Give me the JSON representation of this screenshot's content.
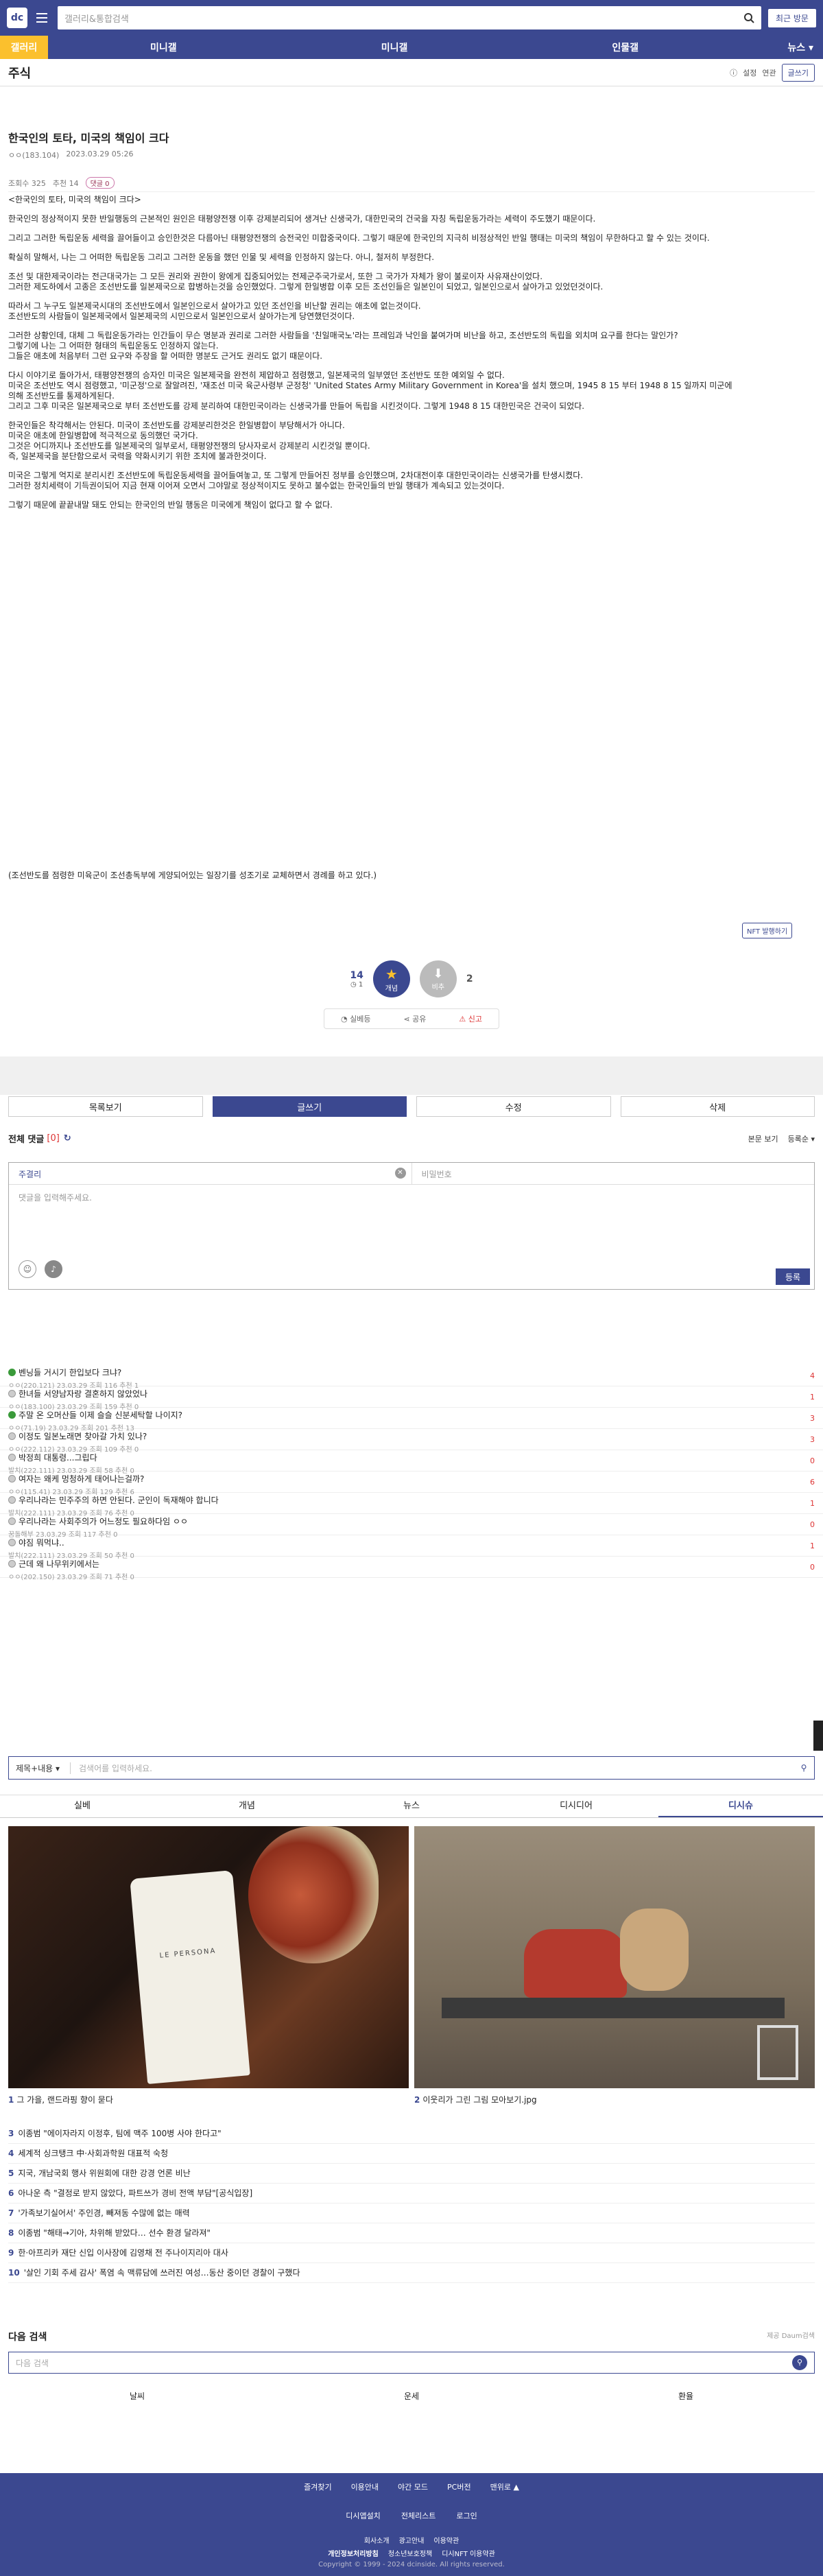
{
  "header": {
    "logo": "dc",
    "search_placeholder": "갤러리&통합검색",
    "recent_label": "최근 방문"
  },
  "gnb": [
    "갤러리",
    "미니갤",
    "미니갤",
    "인물갤",
    "뉴스"
  ],
  "gallery": {
    "title": "주식",
    "setting_label": "설정",
    "link_label": "연관",
    "write_label": "글쓰기"
  },
  "post": {
    "title": "한국인의 토타, 미국의 책임이 크다",
    "author": "ㅇㅇ(183.104)",
    "date": "2023.03.29 05:26",
    "views": "조회수 325",
    "recommend": "추천 14",
    "comments_badge": "댓글 0",
    "paragraphs": [
      [
        "<한국인의 토타, 미국의 책임이 크다>"
      ],
      [
        "한국인의 정상적이지 못한 반일행동의 근본적인 원인은 태평양전쟁 이후 강제분리되어 생겨난 신생국가, 대한민국의 건국을 자칭 독립운동가라는 세력이 주도했기 때문이다."
      ],
      [
        "그리고 그러한 독립운동 세력을 끌어들이고 승인한것은 다름아닌 태평양전쟁의 승전국인 미합중국이다. 그렇기 때문에 한국인의 지극히 비정상적인 반일 행태는 미국의 책임이 무한하다고 할 수 있는 것이다."
      ],
      [
        "확실히 말해서, 나는 그 어떠한 독립운동 그리고 그러한 운동을 했던 인물 및 세력을 인정하지 않는다. 아니, 철저히 부정한다."
      ],
      [
        "조선 및 대한제국이라는 전근대국가는 그 모든 권리와 권한이 왕에게 집중되어있는 전제군주국가로서, 또한 그 국가가 자체가 왕이 불로이자 사유재산이었다.",
        "그러한 제도하에서 고종은 조선반도를 일본제국으로 합병하는것을 승인했었다. 그렇게 한일병합 이후 모든 조선인들은 일본인이 되었고, 일본인으로서 살아가고 있었던것이다."
      ],
      [
        "따라서 그 누구도 일본제국시대의 조선반도에서 일본인으로서 살아가고 있던 조선인을 비난할 권리는 애초에 없는것이다.",
        "조선반도의 사람들이 일본제국에서 일본제국의 시민으로서 일본인으로서 살아가는게 당연했던것이다."
      ],
      [
        "그러한 상황인데, 대체 그 독립운동가라는 인간들이 무슨 명분과 권리로 그러한 사람들을 '친일매국노'라는 프레임과 낙인을 붙여가며 비난을 하고, 조선반도의 독립을 외치며 요구를 한다는 말인가?",
        "그렇기에 나는 그 어떠한 형태의 독립운동도 인정하지 않는다.",
        "그들은 애초에 처음부터 그런 요구와 주장을 할 어떠한 명분도 근거도 권리도 없기 때문이다."
      ],
      [
        "다시 이야기로 돌아가서, 태평양전쟁의 승자인 미국은 일본제국을 완전히 제압하고 점령했고, 일본제국의 일부였던 조선반도 또한 예외일 수 없다.",
        "미국은 조선반도 역시 점령했고, '미군정'으로 잘알려진, '재조선 미국 육군사령부 군정청' 'United States Army Military Government in Korea'을 설치 했으며, 1945 8 15 부터 1948 8 15 일까지 미군에",
        "의해 조선반도를 통제하게된다.",
        "그리고 그후 미국은 일본제국으로 부터 조선반도를 강제 분리하여 대한민국이라는 신생국가를 만들어 독립을 시킨것이다. 그렇게 1948 8 15 대한민국은 건국이 되었다."
      ],
      [
        "한국인들은 착각해서는 안된다. 미국이 조선반도를 강제분리한것은 한일병합이 부당해서가 아니다.",
        "미국은 애초에 한일병합에 적극적으로 동의했던 국가다.",
        "그것은 어디까지나 조선반도를 일본제국의 일부로서, 태평양전쟁의 당사자로서 강제분리 시킨것일 뿐이다.",
        "즉, 일본제국을 분단함으로서 국력을 약화시키기 위한 조치에 불과한것이다."
      ],
      [
        "미국은 그렇게 억지로 분리시킨 조선반도에 독립운동세력을 끌어들여놓고, 또 그렇게 만들어진 정부를 승인했으며, 2차대전이후 대한민국이라는 신생국가를 탄생시켰다.",
        "그러한 정치세력이 기득권이되어 지금 현재 이어져 오면서 그야말로 정상적이지도 못하고 불수없는 한국인들의 반일 행태가 계속되고 있는것이다."
      ],
      [
        "그렇기 때문에 끝끝내말 돼도 안되는 한국인의 반일 행동은 미국에게 책임이 없다고 할 수 없다."
      ]
    ],
    "footnote": "(조선반도를 점령한 미육군이 조선총독부에 게양되어있는 일장기를 성조기로 교체하면서 경례를 하고 있다.)",
    "nft_label": "NFT 발행하기",
    "up_count": "14",
    "up_sub": "1",
    "up_label": "개념",
    "down_label": "비추",
    "down_count": "2",
    "share_items": [
      "실베등",
      "공유",
      "신고"
    ]
  },
  "actions": [
    "목록보기",
    "글쓰기",
    "수정",
    "삭제"
  ],
  "comments": {
    "title": "전체 댓글",
    "count": "[0]",
    "body_view": "본문 보기",
    "sort": "등록순",
    "name_placeholder": "주결리",
    "password_placeholder": "비밀번호",
    "textarea_placeholder": "댓글을 입력해주세요.",
    "submit": "등록"
  },
  "list": [
    {
      "title": "벤닝들 거시기 한입보다 크냐?",
      "meta": "ㅇㅇ(220.121)   23.03.29   조회 116   추천 1",
      "num": "4",
      "icon": "g"
    },
    {
      "title": "한녀들 서양남자랑 결혼하지 않았었나",
      "meta": "ㅇㅇ(183.100)   23.03.29   조회 159   추천 0",
      "num": "1",
      "icon": "n"
    },
    {
      "title": "주말 온 오머산들 이제 슬슬 신분세탁할 나이지?",
      "meta": "ㅇㅇ(71.19)   23.03.29   조회 201   추천 13",
      "num": "3",
      "icon": "g"
    },
    {
      "title": "이정도 일본노래면 찾아갈 가치 있나?",
      "meta": "ㅇㅇ(222.112)   23.03.29   조회 109   추천 0",
      "num": "3",
      "icon": "n"
    },
    {
      "title": "박정희 대통령...그립다",
      "meta": "발치(222.111)   23.03.29   조회 58   추천 0",
      "num": "0",
      "icon": "n"
    },
    {
      "title": "여자는 왜케 멍청하게 태어나는걸까?",
      "meta": "ㅇㅇ(115.41)   23.03.29   조회 129   추천 6",
      "num": "6",
      "icon": "n"
    },
    {
      "title": "우리나라는 민주주의 하면 안된다. 군인이 독재해야 합니다",
      "meta": "발치(222.111)   23.03.29   조회 76   추천 0",
      "num": "1",
      "icon": "n"
    },
    {
      "title": "우리나라는 사회주의가 어느정도 필요하다임 ㅇㅇ",
      "meta": "꿈돌해부   23.03.29   조회 117   추천 0",
      "num": "0",
      "icon": "n"
    },
    {
      "title": "야짐 뭐먹냐..",
      "meta": "발치(222.111)   23.03.29   조회 50   추천 0",
      "num": "1",
      "icon": "n"
    },
    {
      "title": "근데 왜 나무위키에서는",
      "meta": "ㅇㅇ(202.150)   23.03.29   조회 71   추천 0",
      "num": "0",
      "icon": "n"
    }
  ],
  "search2": {
    "select": "제목+내용",
    "placeholder": "검색어를 입력하세요."
  },
  "tabs2": [
    "실베",
    "개념",
    "뉴스",
    "디시디어",
    "디시슈"
  ],
  "photos": {
    "tube_text": "LE PERSONA",
    "cap1": "그 가을, 랜드라핑 향이 묻다",
    "cap2": "이웃리가 그린 그림 모아보기.jpg"
  },
  "rank": [
    {
      "n": "3",
      "t": "이종범 \"에이자라지 이정후, 팀에 맥주 100병 사야 한다고\""
    },
    {
      "n": "4",
      "t": "세계적 싱크탱크 中·사회과학원 대표적 숙청"
    },
    {
      "n": "5",
      "t": "지국, 개남국회 행사 위원회에 대한 강경 언론 비난"
    },
    {
      "n": "6",
      "t": "아나운 측 \"결정로 받지 않았다, 파트쓰가 경비 전액 부담\"[공식입장]"
    },
    {
      "n": "7",
      "t": "'가족보기실어서' 주인경, 빼져동 수많에 없는 매력"
    },
    {
      "n": "8",
      "t": "이종범 \"해태→기아, 차위해 받았다… 선수 환경 달라져\""
    },
    {
      "n": "9",
      "t": "한·아프리카 재단 신입 이사장에 김영채 전 주나이지리아 대사"
    },
    {
      "n": "10",
      "t": "'살인 기회 주세 감사' 폭염 속 맥류담에 쓰러진 여성…동산 중이던 경찰이 구했다"
    }
  ],
  "next_search": {
    "title": "다음 검색",
    "source": "제공 Daum검색",
    "placeholder": "다음 검색"
  },
  "cats": [
    "날씨",
    "운세",
    "환율"
  ],
  "footer": {
    "r1": [
      "즐겨찾기",
      "이용안내",
      "야간 모드",
      "PC버전",
      "맨위로 ▲"
    ],
    "r2": [
      "디시앱설치",
      "전체리스트",
      "로그인"
    ],
    "r3": [
      "회사소개",
      "광고안내",
      "이용약관"
    ],
    "r4": [
      "개인정보처리방침",
      "청소년보호정책",
      "디시NFT 이용약관"
    ],
    "copyright": "Copyright © 1999 - 2024 dcinside. All rights reserved."
  }
}
